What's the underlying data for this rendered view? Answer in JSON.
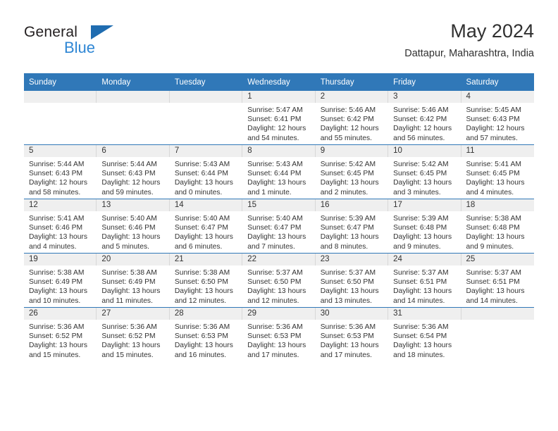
{
  "branding": {
    "logo_primary": "General",
    "logo_secondary": "Blue",
    "logo_triangle_color": "#1f6cb0",
    "logo_secondary_color": "#2e86d4"
  },
  "header": {
    "title": "May 2024",
    "subtitle": "Dattapur, Maharashtra, India"
  },
  "theme": {
    "header_blue": "#3078b8",
    "daynum_band": "#efefef",
    "text": "#333333"
  },
  "calendar": {
    "weekday_headers": [
      "Sunday",
      "Monday",
      "Tuesday",
      "Wednesday",
      "Thursday",
      "Friday",
      "Saturday"
    ],
    "weeks": [
      [
        {
          "day": "",
          "empty": true
        },
        {
          "day": "",
          "empty": true
        },
        {
          "day": "",
          "empty": true
        },
        {
          "day": "1",
          "sunrise": "Sunrise: 5:47 AM",
          "sunset": "Sunset: 6:41 PM",
          "daylight": "Daylight: 12 hours and 54 minutes."
        },
        {
          "day": "2",
          "sunrise": "Sunrise: 5:46 AM",
          "sunset": "Sunset: 6:42 PM",
          "daylight": "Daylight: 12 hours and 55 minutes."
        },
        {
          "day": "3",
          "sunrise": "Sunrise: 5:46 AM",
          "sunset": "Sunset: 6:42 PM",
          "daylight": "Daylight: 12 hours and 56 minutes."
        },
        {
          "day": "4",
          "sunrise": "Sunrise: 5:45 AM",
          "sunset": "Sunset: 6:43 PM",
          "daylight": "Daylight: 12 hours and 57 minutes."
        }
      ],
      [
        {
          "day": "5",
          "sunrise": "Sunrise: 5:44 AM",
          "sunset": "Sunset: 6:43 PM",
          "daylight": "Daylight: 12 hours and 58 minutes."
        },
        {
          "day": "6",
          "sunrise": "Sunrise: 5:44 AM",
          "sunset": "Sunset: 6:43 PM",
          "daylight": "Daylight: 12 hours and 59 minutes."
        },
        {
          "day": "7",
          "sunrise": "Sunrise: 5:43 AM",
          "sunset": "Sunset: 6:44 PM",
          "daylight": "Daylight: 13 hours and 0 minutes."
        },
        {
          "day": "8",
          "sunrise": "Sunrise: 5:43 AM",
          "sunset": "Sunset: 6:44 PM",
          "daylight": "Daylight: 13 hours and 1 minute."
        },
        {
          "day": "9",
          "sunrise": "Sunrise: 5:42 AM",
          "sunset": "Sunset: 6:45 PM",
          "daylight": "Daylight: 13 hours and 2 minutes."
        },
        {
          "day": "10",
          "sunrise": "Sunrise: 5:42 AM",
          "sunset": "Sunset: 6:45 PM",
          "daylight": "Daylight: 13 hours and 3 minutes."
        },
        {
          "day": "11",
          "sunrise": "Sunrise: 5:41 AM",
          "sunset": "Sunset: 6:45 PM",
          "daylight": "Daylight: 13 hours and 4 minutes."
        }
      ],
      [
        {
          "day": "12",
          "sunrise": "Sunrise: 5:41 AM",
          "sunset": "Sunset: 6:46 PM",
          "daylight": "Daylight: 13 hours and 4 minutes."
        },
        {
          "day": "13",
          "sunrise": "Sunrise: 5:40 AM",
          "sunset": "Sunset: 6:46 PM",
          "daylight": "Daylight: 13 hours and 5 minutes."
        },
        {
          "day": "14",
          "sunrise": "Sunrise: 5:40 AM",
          "sunset": "Sunset: 6:47 PM",
          "daylight": "Daylight: 13 hours and 6 minutes."
        },
        {
          "day": "15",
          "sunrise": "Sunrise: 5:40 AM",
          "sunset": "Sunset: 6:47 PM",
          "daylight": "Daylight: 13 hours and 7 minutes."
        },
        {
          "day": "16",
          "sunrise": "Sunrise: 5:39 AM",
          "sunset": "Sunset: 6:47 PM",
          "daylight": "Daylight: 13 hours and 8 minutes."
        },
        {
          "day": "17",
          "sunrise": "Sunrise: 5:39 AM",
          "sunset": "Sunset: 6:48 PM",
          "daylight": "Daylight: 13 hours and 9 minutes."
        },
        {
          "day": "18",
          "sunrise": "Sunrise: 5:38 AM",
          "sunset": "Sunset: 6:48 PM",
          "daylight": "Daylight: 13 hours and 9 minutes."
        }
      ],
      [
        {
          "day": "19",
          "sunrise": "Sunrise: 5:38 AM",
          "sunset": "Sunset: 6:49 PM",
          "daylight": "Daylight: 13 hours and 10 minutes."
        },
        {
          "day": "20",
          "sunrise": "Sunrise: 5:38 AM",
          "sunset": "Sunset: 6:49 PM",
          "daylight": "Daylight: 13 hours and 11 minutes."
        },
        {
          "day": "21",
          "sunrise": "Sunrise: 5:38 AM",
          "sunset": "Sunset: 6:50 PM",
          "daylight": "Daylight: 13 hours and 12 minutes."
        },
        {
          "day": "22",
          "sunrise": "Sunrise: 5:37 AM",
          "sunset": "Sunset: 6:50 PM",
          "daylight": "Daylight: 13 hours and 12 minutes."
        },
        {
          "day": "23",
          "sunrise": "Sunrise: 5:37 AM",
          "sunset": "Sunset: 6:50 PM",
          "daylight": "Daylight: 13 hours and 13 minutes."
        },
        {
          "day": "24",
          "sunrise": "Sunrise: 5:37 AM",
          "sunset": "Sunset: 6:51 PM",
          "daylight": "Daylight: 13 hours and 14 minutes."
        },
        {
          "day": "25",
          "sunrise": "Sunrise: 5:37 AM",
          "sunset": "Sunset: 6:51 PM",
          "daylight": "Daylight: 13 hours and 14 minutes."
        }
      ],
      [
        {
          "day": "26",
          "sunrise": "Sunrise: 5:36 AM",
          "sunset": "Sunset: 6:52 PM",
          "daylight": "Daylight: 13 hours and 15 minutes."
        },
        {
          "day": "27",
          "sunrise": "Sunrise: 5:36 AM",
          "sunset": "Sunset: 6:52 PM",
          "daylight": "Daylight: 13 hours and 15 minutes."
        },
        {
          "day": "28",
          "sunrise": "Sunrise: 5:36 AM",
          "sunset": "Sunset: 6:53 PM",
          "daylight": "Daylight: 13 hours and 16 minutes."
        },
        {
          "day": "29",
          "sunrise": "Sunrise: 5:36 AM",
          "sunset": "Sunset: 6:53 PM",
          "daylight": "Daylight: 13 hours and 17 minutes."
        },
        {
          "day": "30",
          "sunrise": "Sunrise: 5:36 AM",
          "sunset": "Sunset: 6:53 PM",
          "daylight": "Daylight: 13 hours and 17 minutes."
        },
        {
          "day": "31",
          "sunrise": "Sunrise: 5:36 AM",
          "sunset": "Sunset: 6:54 PM",
          "daylight": "Daylight: 13 hours and 18 minutes."
        },
        {
          "day": "",
          "empty": true
        }
      ]
    ]
  }
}
